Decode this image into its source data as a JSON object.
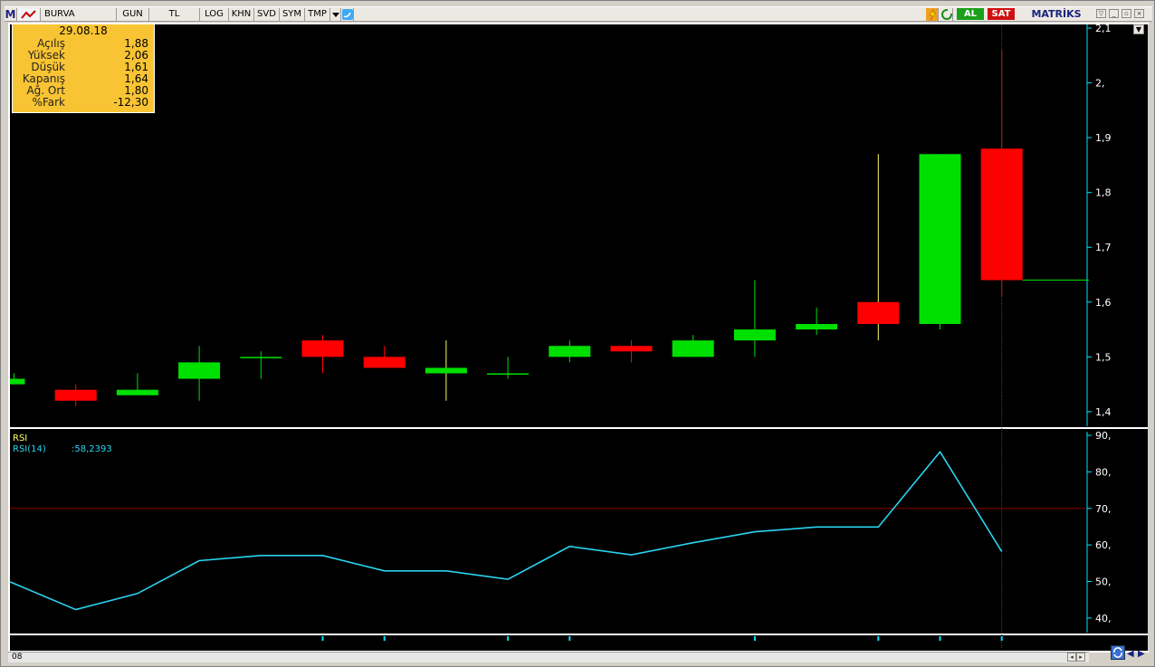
{
  "toolbar": {
    "logo": "M",
    "symbol": "BURVA",
    "period": "GUN",
    "currency": "TL",
    "buttons": [
      "LOG",
      "KHN",
      "SVD",
      "SYM",
      "TMP"
    ],
    "al_label": "AL",
    "sat_label": "SAT",
    "brand": "MATRİKS"
  },
  "info": {
    "date": "29.08.18",
    "rows": [
      {
        "k": "Açılış",
        "v": "1,88"
      },
      {
        "k": "Yüksek",
        "v": "2,06"
      },
      {
        "k": "Düşük",
        "v": "1,61"
      },
      {
        "k": "Kapanış",
        "v": "1,64"
      },
      {
        "k": "Ağ. Ort",
        "v": "1,80"
      },
      {
        "k": "%Fark",
        "v": "-12,30"
      }
    ]
  },
  "rsi_panel": {
    "title": "RSI",
    "series_label": "RSI(14)",
    "series_value": ":58,2393"
  },
  "scroll_label": "08",
  "colors": {
    "up": "#00e000",
    "down": "#ff0000",
    "axis": "#00e5ff",
    "rsi": "#2ad4f0",
    "ref": "#8b0000"
  },
  "chart_data": [
    {
      "type": "candlestick",
      "ylim": [
        1.38,
        2.1
      ],
      "yticks": [
        "1,4",
        "1,5",
        "1,6",
        "1,7",
        "1,8",
        "1,9",
        "2,",
        "2,1"
      ],
      "ytick_values": [
        1.4,
        1.5,
        1.6,
        1.7,
        1.8,
        1.9,
        2.0,
        2.1
      ],
      "candles": [
        {
          "o": 1.45,
          "h": 1.47,
          "l": 1.45,
          "c": 1.46
        },
        {
          "o": 1.44,
          "h": 1.45,
          "l": 1.41,
          "c": 1.42
        },
        {
          "o": 1.43,
          "h": 1.47,
          "l": 1.43,
          "c": 1.44
        },
        {
          "o": 1.46,
          "h": 1.52,
          "l": 1.42,
          "c": 1.49
        },
        {
          "o": 1.5,
          "h": 1.51,
          "l": 1.46,
          "c": 1.5
        },
        {
          "o": 1.53,
          "h": 1.54,
          "l": 1.47,
          "c": 1.5
        },
        {
          "o": 1.5,
          "h": 1.52,
          "l": 1.48,
          "c": 1.48
        },
        {
          "o": 1.47,
          "h": 1.53,
          "l": 1.42,
          "c": 1.48
        },
        {
          "o": 1.47,
          "h": 1.5,
          "l": 1.46,
          "c": 1.47
        },
        {
          "o": 1.5,
          "h": 1.53,
          "l": 1.49,
          "c": 1.52
        },
        {
          "o": 1.52,
          "h": 1.53,
          "l": 1.49,
          "c": 1.51
        },
        {
          "o": 1.5,
          "h": 1.54,
          "l": 1.5,
          "c": 1.53
        },
        {
          "o": 1.53,
          "h": 1.64,
          "l": 1.5,
          "c": 1.55
        },
        {
          "o": 1.55,
          "h": 1.59,
          "l": 1.54,
          "c": 1.56
        },
        {
          "o": 1.6,
          "h": 1.87,
          "l": 1.53,
          "c": 1.56
        },
        {
          "o": 1.56,
          "h": 1.87,
          "l": 1.55,
          "c": 1.87
        },
        {
          "o": 1.88,
          "h": 2.06,
          "l": 1.61,
          "c": 1.64
        }
      ],
      "last_price": 1.64
    },
    {
      "type": "line",
      "series": [
        {
          "name": "RSI(14)",
          "values": [
            49.9,
            42.3,
            46.7,
            55.7,
            57.1,
            57.1,
            52.9,
            52.9,
            50.6,
            59.6,
            57.3,
            60.6,
            63.6,
            64.9,
            64.9,
            85.5,
            58.2
          ]
        }
      ],
      "ylim": [
        36,
        91
      ],
      "yticks": [
        "40,",
        "50,",
        "60,",
        "70,",
        "80,",
        "90,"
      ],
      "ytick_values": [
        40,
        50,
        60,
        70,
        80,
        90
      ],
      "reference_line": 70
    }
  ]
}
